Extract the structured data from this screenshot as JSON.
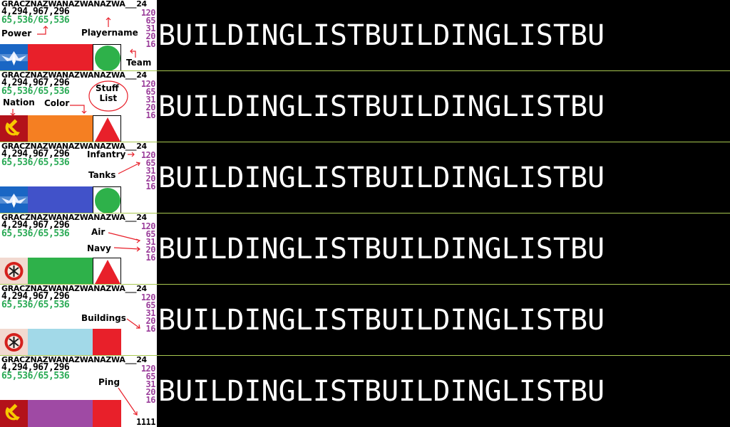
{
  "player": {
    "name": "GRACZNAZWANAZWANAZWA___24",
    "name2": "GRACZNAZWANAZWANAZWA___24",
    "money": "4,294,967,296",
    "power": "65,536/65,536"
  },
  "stats": {
    "infantry": "120",
    "tanks": "65",
    "air": "31",
    "navy": "20",
    "buildings": "16"
  },
  "ping": "1111",
  "building_list": "BUILDINGLISTBUILDINGLISTBU",
  "annotations": {
    "power": "Power",
    "playername": "Playername",
    "team": "Team",
    "nation": "Nation",
    "color": "Color",
    "stuff": "Stuff",
    "list": "List",
    "infantry": "Infantry",
    "tanks": "Tanks",
    "air": "Air",
    "navy": "Navy",
    "buildings": "Buildings",
    "ping": "Ping"
  },
  "rows": [
    {
      "nation": "eagle-icon",
      "color": "#e8202a",
      "team": "circle"
    },
    {
      "nation": "hammer-sickle-icon",
      "color": "#f57f22",
      "team": "triangle"
    },
    {
      "nation": "eagle-icon",
      "color": "#4152c9",
      "team": "circle"
    },
    {
      "nation": "yuri-icon",
      "color": "#2eb14a",
      "team": "triangle"
    },
    {
      "nation": "yuri-icon",
      "color": "#a2d9e8",
      "team": "square"
    },
    {
      "nation": "hammer-sickle-icon",
      "color": "#9f4aa4",
      "team": "square"
    }
  ]
}
